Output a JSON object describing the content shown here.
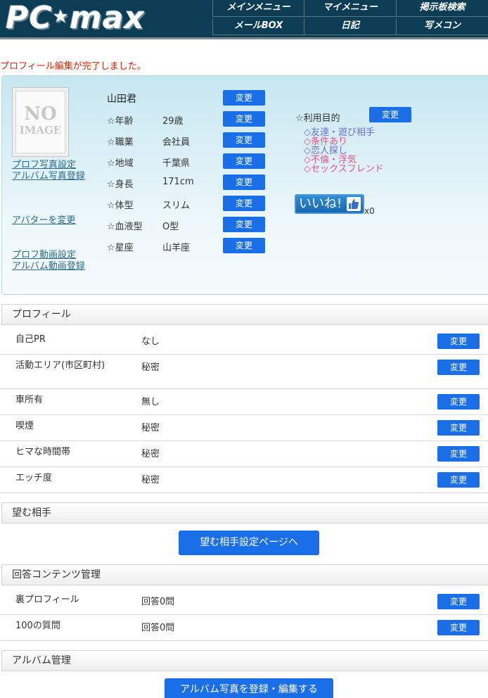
{
  "header": {
    "logo": {
      "left": "PC",
      "star": "★",
      "right": "max"
    },
    "nav": [
      {
        "label": "メインメニュー"
      },
      {
        "label": "マイメニュー"
      },
      {
        "label": "掲示板検索"
      },
      {
        "label": "メールBOX"
      },
      {
        "label": "日記"
      },
      {
        "label": "写メコン"
      }
    ]
  },
  "notice": "プロフィール編集が完了しました。",
  "profile": {
    "image": {
      "line1": "NO",
      "line2": "IMAGE"
    },
    "links": {
      "photo_setting": "プロフ写真設定",
      "album_photo": "アルバム写真登録",
      "avatar": "アバターを変更",
      "video_setting": "プロフ動画設定",
      "album_video": "アルバム動画登録"
    },
    "name": "山田君",
    "change_label": "変更",
    "attributes": [
      {
        "label": "☆年齢",
        "value": "29歳"
      },
      {
        "label": "☆職業",
        "value": "会社員"
      },
      {
        "label": "☆地域",
        "value": "千葉県"
      },
      {
        "label": "☆身長",
        "value": "171cm"
      },
      {
        "label": "☆体型",
        "value": "スリム"
      },
      {
        "label": "☆血液型",
        "value": "O型"
      },
      {
        "label": "☆星座",
        "value": "山羊座"
      }
    ],
    "purpose": {
      "label": "☆利用目的",
      "items": [
        {
          "text": "◇友達・遊び相手",
          "color": "#6a6fd6"
        },
        {
          "text": "◇条件あり",
          "color": "#e8508a"
        },
        {
          "text": "◇恋人探し",
          "color": "#6a6fd6"
        },
        {
          "text": "◇不倫・浮気",
          "color": "#e8508a"
        },
        {
          "text": "◇セックスフレンド",
          "color": "#e8508a"
        }
      ]
    },
    "like": {
      "label": "いいね!",
      "icon": "thumbs-up-icon",
      "count": "x0"
    }
  },
  "sections": {
    "profile": {
      "title": "プロフィール",
      "rows": [
        {
          "label": "自己PR",
          "value": "なし"
        },
        {
          "label": "活動エリア(市区町村)",
          "value": "秘密"
        },
        {
          "label": "車所有",
          "value": "無し"
        },
        {
          "label": "喫煙",
          "value": "秘密"
        },
        {
          "label": "ヒマな時間帯",
          "value": "秘密"
        },
        {
          "label": "エッチ度",
          "value": "秘密"
        }
      ]
    },
    "partner": {
      "title": "望む相手",
      "button": "望む相手設定ページへ"
    },
    "answers": {
      "title": "回答コンテンツ管理",
      "rows": [
        {
          "label": "裏プロフィール",
          "value": "回答0問"
        },
        {
          "label": "100の質問",
          "value": "回答0問"
        }
      ]
    },
    "album": {
      "title": "アルバム管理",
      "button": "アルバム写真を登録・編集する"
    }
  }
}
